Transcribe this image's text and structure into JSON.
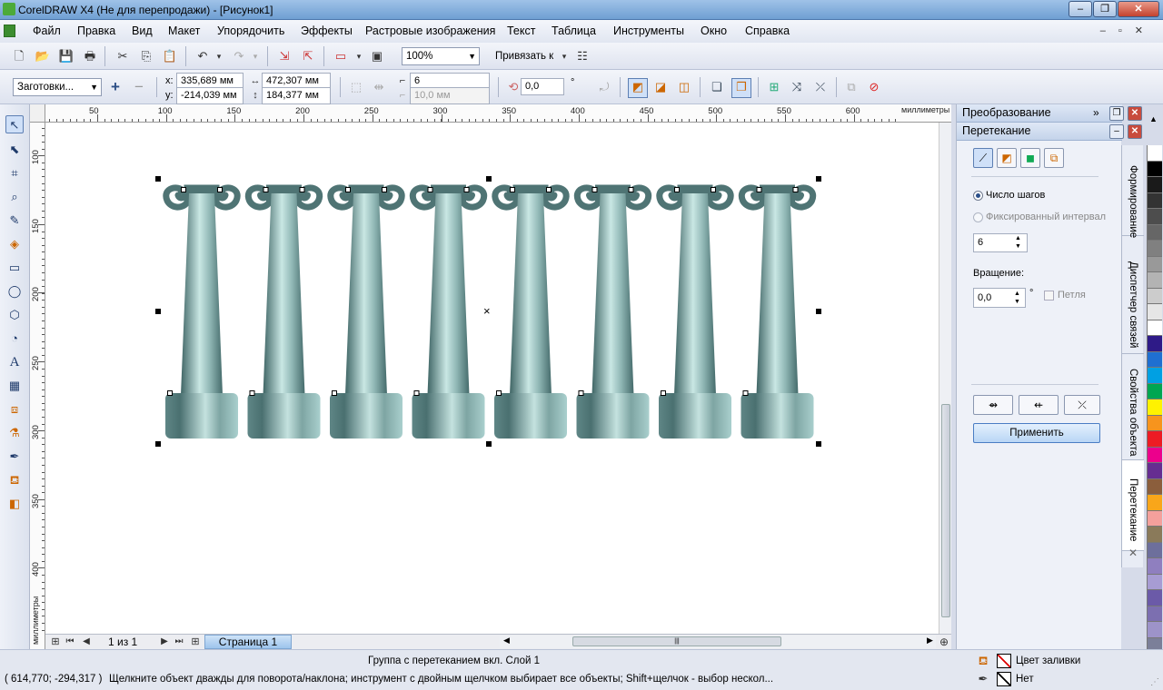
{
  "window": {
    "title": "CorelDRAW X4 (Не для перепродажи) - [Рисунок1]"
  },
  "menu": [
    "Файл",
    "Правка",
    "Вид",
    "Макет",
    "Упорядочить",
    "Эффекты",
    "Растровые изображения",
    "Текст",
    "Таблица",
    "Инструменты",
    "Окно",
    "Справка"
  ],
  "toolbar": {
    "zoom": "100%",
    "snap_label": "Привязать к"
  },
  "propbar": {
    "presets": "Заготовки...",
    "x_label": "x:",
    "x_value": "335,689 мм",
    "y_label": "y:",
    "y_value": "-214,039 мм",
    "width_value": "472,307 мм",
    "height_value": "184,377 мм",
    "steps_value": "6",
    "spacing_value": "10,0 мм",
    "rotation_value": "0,0",
    "degree": "°"
  },
  "ruler": {
    "h_labels": [
      "50",
      "100",
      "150",
      "200",
      "250",
      "300",
      "350",
      "400",
      "450",
      "500",
      "550",
      "600"
    ],
    "h_unit": "миллиметры",
    "v_labels": [
      "100",
      "150",
      "200",
      "250",
      "300",
      "350",
      "400"
    ],
    "v_unit": "миллиметры"
  },
  "pagebar": {
    "page_count": "1 из 1",
    "page_tab": "Страница 1"
  },
  "docker": {
    "transform_title": "Преобразование",
    "blend_title": "Перетекание",
    "steps_radio": "Число шагов",
    "fixed_radio": "Фиксированный интервал",
    "steps_value": "6",
    "rotation_label": "Вращение:",
    "rotation_value": "0,0",
    "degree": "°",
    "loop_label": "Петля",
    "apply_button": "Применить"
  },
  "docker_tabs": [
    "Формирование",
    "Диспетчер связей",
    "Свойства объекта",
    "Перетекание"
  ],
  "palette": [
    "#ffffff",
    "#000000",
    "#1a1a1a",
    "#333333",
    "#4d4d4d",
    "#666666",
    "#808080",
    "#999999",
    "#b3b3b3",
    "#cccccc",
    "#e6e6e6",
    "#ffffff",
    "#2e1a87",
    "#1f6fd1",
    "#00a0e3",
    "#00a651",
    "#fff200",
    "#f7941d",
    "#ed1c24",
    "#ec008c",
    "#662d91",
    "#8b5e3c",
    "#f9a61a",
    "#f4a09c",
    "#8a7a5a",
    "#6d6f9c",
    "#8f7fbf",
    "#a79cd3",
    "#6b5aa8",
    "#7c6fb0",
    "#9d93c9",
    "#7b7f99",
    "#5f6378"
  ],
  "status": {
    "info": "Группа с перетеканием вкл. Слой 1",
    "coords": "( 614,770; -294,317 )",
    "hint": "Щелкните объект дважды для поворота/наклона; инструмент с двойным щелчком выбирает все объекты; Shift+щелчок - выбор нескол...",
    "fill_label": "Цвет заливки",
    "outline_label": "Нет"
  },
  "colors": {
    "column_dark": "#4f7474",
    "column_light": "#bfe0de",
    "accent": "#9db8dd"
  }
}
